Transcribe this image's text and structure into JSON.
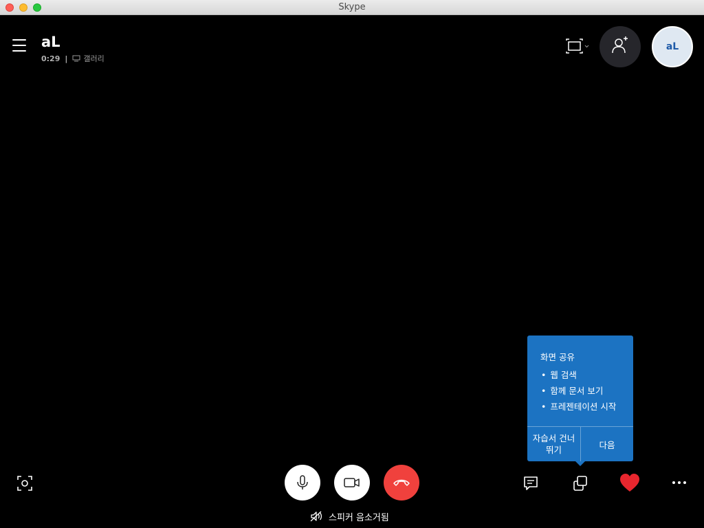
{
  "window": {
    "title": "Skype"
  },
  "call": {
    "title": "aL",
    "timer": "0:29",
    "separator": "|",
    "view_label": "갤러리"
  },
  "participant": {
    "initials": "aL"
  },
  "tooltip": {
    "title": "화면 공유",
    "items": [
      "웹 검색",
      "함께 문서 보기",
      "프레젠테이션 시작"
    ],
    "skip_label": "자습서 건너뛰기",
    "next_label": "다음"
  },
  "status": {
    "speaker_muted": "스피커 음소거됨"
  },
  "colors": {
    "accent": "#1c73c2",
    "hangup": "#f0413d",
    "heart": "#e8262e",
    "background": "#000000"
  },
  "icons": {
    "menu": "hamburger-menu-icon",
    "layout": "fullscreen-frame-icon",
    "add_person": "add-person-icon",
    "screenshot": "camera-capture-icon",
    "mic": "microphone-icon",
    "video": "video-camera-icon",
    "hangup": "phone-hangup-icon",
    "chat": "chat-icon",
    "share": "share-screen-icon",
    "react": "heart-icon",
    "more": "more-dots-icon",
    "speaker": "speaker-muted-icon"
  }
}
